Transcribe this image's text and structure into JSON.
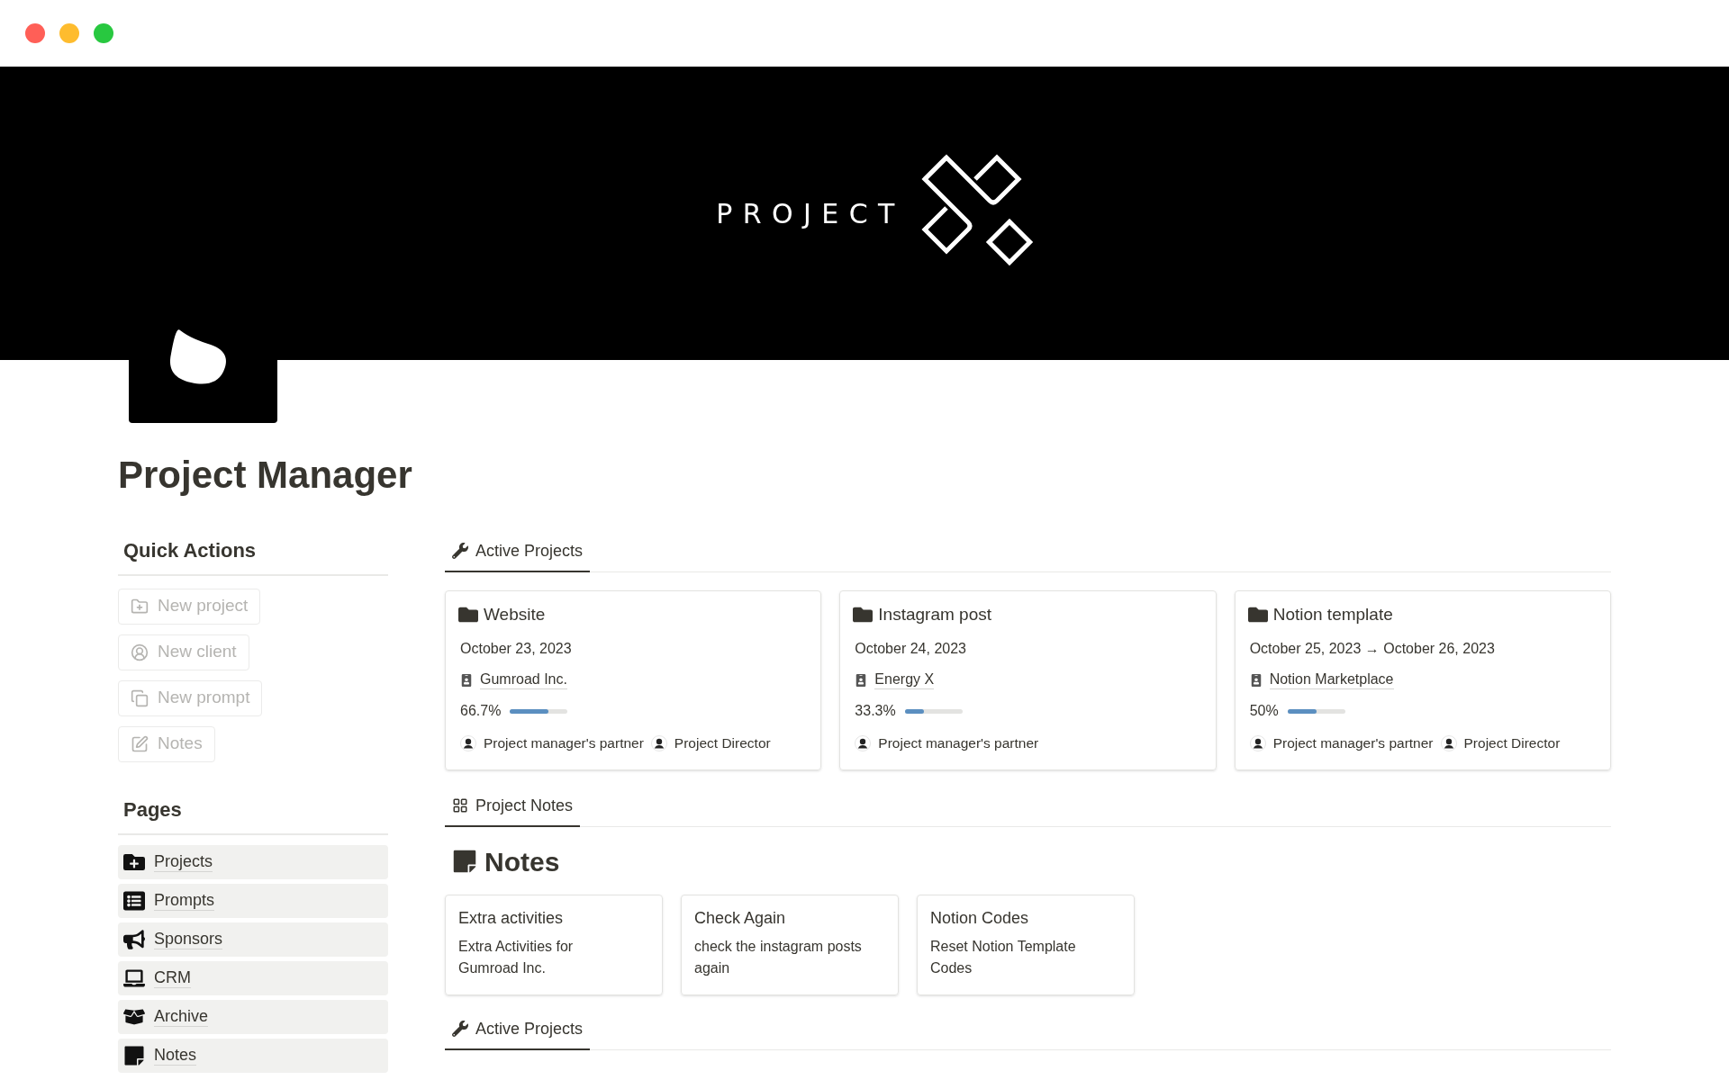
{
  "window": {
    "controls": [
      {
        "color": "#ff5f57"
      },
      {
        "color": "#febc2e"
      },
      {
        "color": "#28c840"
      }
    ]
  },
  "cover": {
    "logo_text": "PROJECT"
  },
  "page": {
    "title": "Project Manager"
  },
  "quick_actions": {
    "heading": "Quick Actions",
    "buttons": [
      {
        "label": "New project",
        "disabled": true
      },
      {
        "label": "New client",
        "disabled": true
      },
      {
        "label": "New prompt",
        "disabled": true
      },
      {
        "label": "Notes",
        "disabled": true
      }
    ]
  },
  "pages": {
    "heading": "Pages",
    "items": [
      {
        "label": "Projects"
      },
      {
        "label": "Prompts"
      },
      {
        "label": "Sponsors"
      },
      {
        "label": "CRM"
      },
      {
        "label": "Archive"
      },
      {
        "label": "Notes"
      }
    ]
  },
  "active_projects": {
    "tab": {
      "label": "Active Projects",
      "selected": true
    },
    "cards": [
      {
        "name": "Website",
        "date": "October 23, 2023",
        "client": "Gumroad Inc.",
        "progress": "66.7%",
        "level": 0.667,
        "people": [
          "Project manager's partner",
          "Project Director"
        ]
      },
      {
        "name": "Instagram post",
        "date": "October 24, 2023",
        "client": "Energy X",
        "progress": "33.3%",
        "level": 0.333,
        "people": [
          "Project manager's partner"
        ]
      },
      {
        "name": "Notion template",
        "date": "October 25, 2023 → October 26, 2023",
        "client": "Notion Marketplace",
        "progress": "50%",
        "level": 0.5,
        "people": [
          "Project manager's partner",
          "Project Director"
        ]
      }
    ]
  },
  "project_notes": {
    "tab": {
      "label": "Project Notes",
      "selected": true
    },
    "heading": "Notes",
    "cards": [
      {
        "title": "Extra activities",
        "text": "Extra Activities for Gumroad Inc."
      },
      {
        "title": "Check Again",
        "text": "check the instagram posts again"
      },
      {
        "title": "Notion Codes",
        "text": "Reset Notion Template Codes"
      }
    ]
  },
  "active_projects_2": {
    "tab": {
      "label": "Active Projects",
      "selected": true
    }
  }
}
